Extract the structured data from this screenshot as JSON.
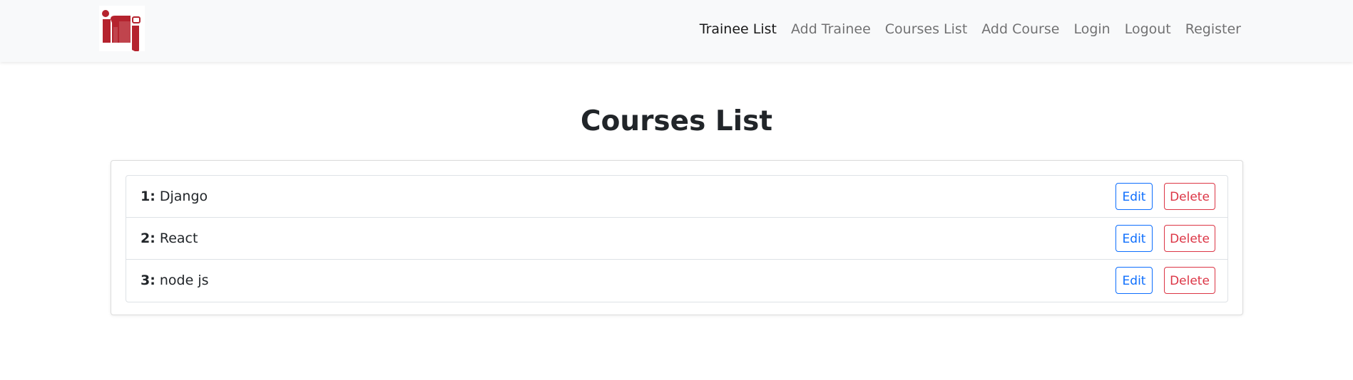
{
  "navbar": {
    "logo_alt": "iti logo",
    "links": [
      {
        "label": "Trainee List",
        "active": true
      },
      {
        "label": "Add Trainee",
        "active": false
      },
      {
        "label": "Courses List",
        "active": false
      },
      {
        "label": "Add Course",
        "active": false
      },
      {
        "label": "Login",
        "active": false
      },
      {
        "label": "Logout",
        "active": false
      },
      {
        "label": "Register",
        "active": false
      }
    ]
  },
  "main": {
    "title": "Courses List",
    "courses": [
      {
        "num": "1:",
        "name": " Django",
        "edit_label": "Edit",
        "delete_label": "Delete"
      },
      {
        "num": "2:",
        "name": " React",
        "edit_label": "Edit",
        "delete_label": "Delete"
      },
      {
        "num": "3:",
        "name": " node js",
        "edit_label": "Edit",
        "delete_label": "Delete"
      }
    ]
  },
  "colors": {
    "brand_red": "#b5232e",
    "edit_blue": "#0d6efd",
    "delete_red": "#dc3545"
  }
}
